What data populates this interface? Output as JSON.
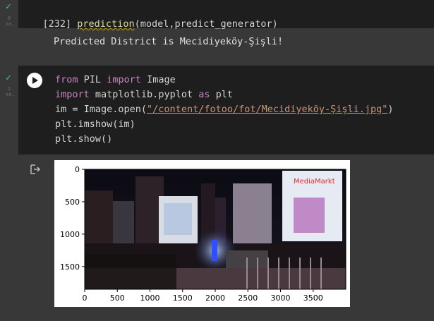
{
  "cell1": {
    "exec_count": "[232]",
    "code_fn": "prediction",
    "code_args": "(model,predict_generator)",
    "status_sub": "0\nsn.",
    "output": "Predicted District is Mecidiyeköy-Şişli!"
  },
  "cell2": {
    "status_sub": "1\nsn.",
    "line1": {
      "kw1": "from",
      "mod": " PIL ",
      "kw2": "import",
      "name": " Image"
    },
    "line2": {
      "kw1": "import",
      "mod": " matplotlib.pyplot ",
      "kw2": "as",
      "name": " plt"
    },
    "line3": {
      "pre": "im = Image.open(",
      "str": "\"/content/fotoo/fot/Mecidiyeköy-Şişli.jpg\"",
      "post": ")"
    },
    "line4": "plt.imshow(im)",
    "line5": "plt.show()"
  },
  "chart_data": {
    "type": "image",
    "xlabel": "",
    "ylabel": "",
    "xlim": [
      0,
      4000
    ],
    "ylim": [
      1850,
      0
    ],
    "xticks": [
      "0",
      "500",
      "1000",
      "1500",
      "2000",
      "2500",
      "3000",
      "3500"
    ],
    "yticks": [
      "0",
      "500",
      "1000",
      "1500"
    ]
  },
  "colors": {
    "success": "#36d16c",
    "background": "#383838",
    "cell": "#1e1e1e",
    "keyword": "#c586c0",
    "string": "#ce9178"
  }
}
